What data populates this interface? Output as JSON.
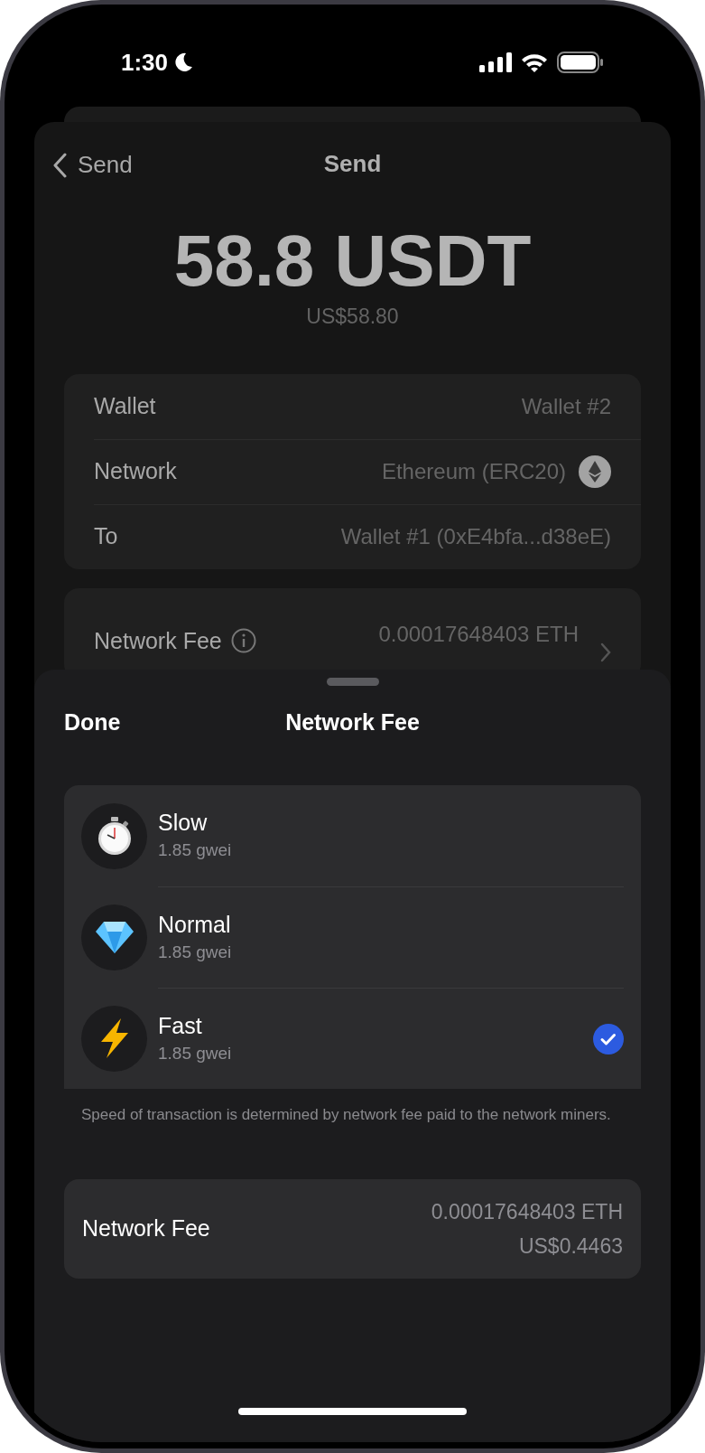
{
  "status_bar": {
    "time": "1:30"
  },
  "nav": {
    "back_label": "Send",
    "title": "Send"
  },
  "amount": {
    "value": "58.8 USDT",
    "fiat": "US$58.80"
  },
  "details": [
    {
      "label": "Wallet",
      "value": "Wallet #2",
      "kind": "text"
    },
    {
      "label": "Network",
      "value": "Ethereum (ERC20)",
      "kind": "network"
    },
    {
      "label": "To",
      "value": "Wallet #1 (0xE4bfa...d38eE)",
      "kind": "text"
    }
  ],
  "fee_row": {
    "label": "Network Fee",
    "value": "0.00017648403 ETH"
  },
  "sheet": {
    "done": "Done",
    "title": "Network Fee",
    "options": [
      {
        "name": "Slow",
        "rate": "1.85 gwei",
        "kind": "stopwatch",
        "selected": false
      },
      {
        "name": "Normal",
        "rate": "1.85 gwei",
        "kind": "diamond",
        "selected": false
      },
      {
        "name": "Fast",
        "rate": "1.85 gwei",
        "kind": "lightning",
        "selected": true
      }
    ],
    "caption": "Speed of transaction is determined by network fee paid to the network miners.",
    "fee": {
      "label": "Network Fee",
      "crypto": "0.00017648403 ETH",
      "fiat": "US$0.4463"
    }
  }
}
